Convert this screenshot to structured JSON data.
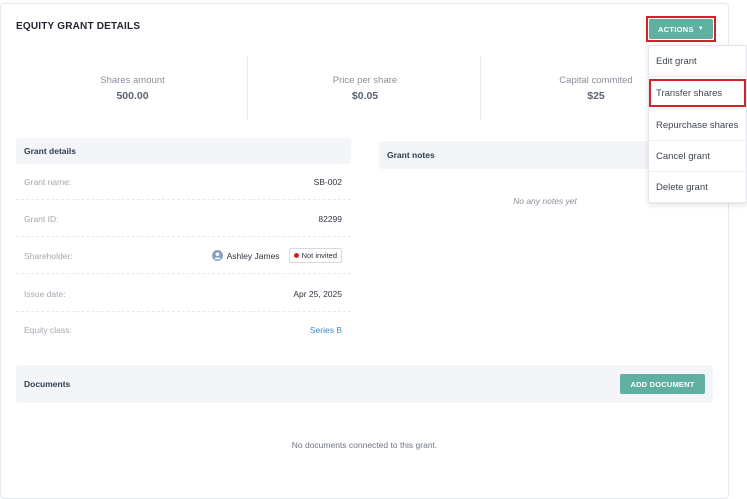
{
  "page": {
    "title": "EQUITY GRANT DETAILS"
  },
  "actions": {
    "label": "ACTIONS",
    "caret": "▼"
  },
  "stats": [
    {
      "label": "Shares amount",
      "value": "500.00"
    },
    {
      "label": "Price per share",
      "value": "$0.05"
    },
    {
      "label": "Capital commited",
      "value": "$25"
    }
  ],
  "grant_details": {
    "title": "Grant details",
    "rows": [
      {
        "label": "Grant name:",
        "value": "SB-002"
      },
      {
        "label": "Grant ID:",
        "value": "82299"
      },
      {
        "label": "Shareholder:",
        "value": "Ashley James",
        "badge": "Not invited"
      },
      {
        "label": "Issue date:",
        "value": "Apr 25, 2025"
      },
      {
        "label": "Equity class:",
        "value": "Series B"
      }
    ]
  },
  "grant_notes": {
    "title": "Grant notes",
    "empty": "No any notes yet"
  },
  "documents": {
    "title": "Documents",
    "add_label": "ADD DOCUMENT",
    "empty": "No documents connected to this grant."
  },
  "menu": {
    "items": [
      {
        "label": "Edit grant"
      },
      {
        "label": "Transfer shares",
        "highlighted": true
      },
      {
        "label": "Repurchase shares"
      },
      {
        "label": "Cancel grant"
      },
      {
        "label": "Delete grant"
      }
    ]
  },
  "colors": {
    "accent": "#5fb0a0",
    "highlight": "#d0232a",
    "link": "#3d8bbf",
    "status_dot": "#c62828"
  }
}
